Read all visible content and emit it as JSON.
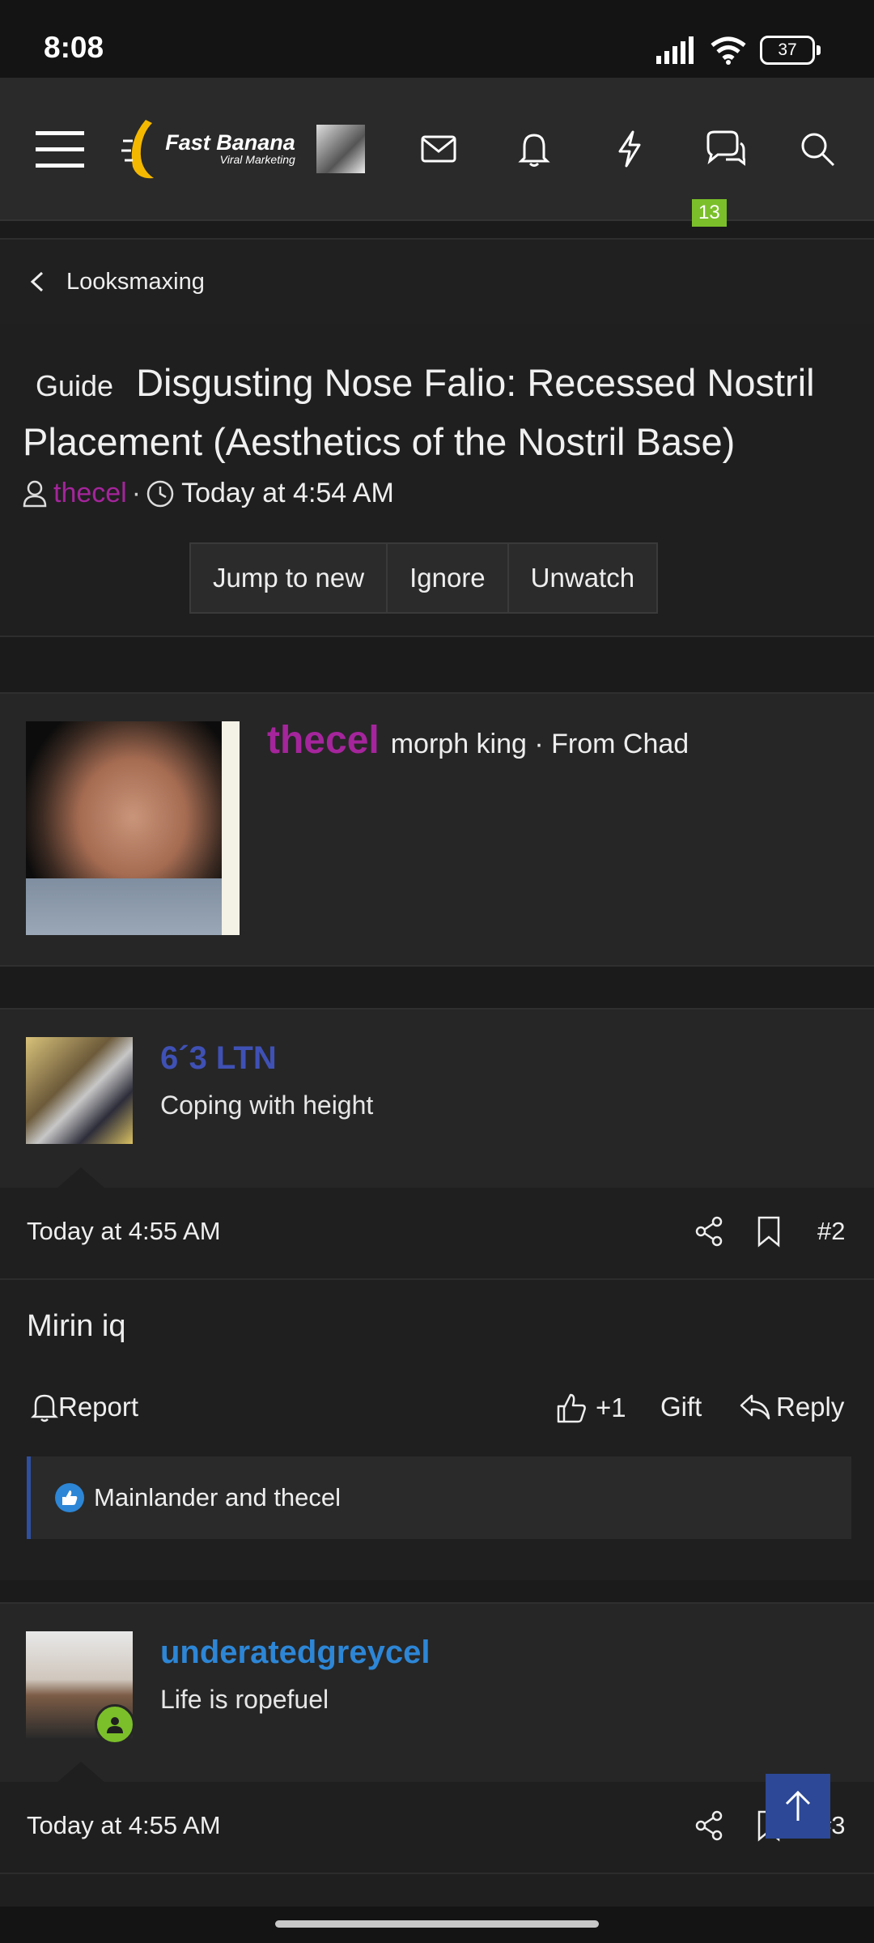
{
  "status": {
    "time": "8:08",
    "battery": "37"
  },
  "nav": {
    "logo_main": "Fast Banana",
    "logo_sub": "Viral Marketing",
    "convo_badge": "13"
  },
  "breadcrumb": {
    "label": "Looksmaxing"
  },
  "thread": {
    "prefix": "Guide",
    "title": "Disgusting Nose Falio: Recessed Nostril Placement (Aesthetics of the Nostril Base)",
    "author": "thecel",
    "separator": "·",
    "time": "Today at 4:54 AM",
    "buttons": [
      "Jump to new",
      "Ignore",
      "Unwatch"
    ]
  },
  "first_post": {
    "username": "thecel",
    "user_title": "morph king · From Chad"
  },
  "posts": [
    {
      "username": "6´3 LTN",
      "user_title": "Coping with height",
      "name_color": "#3f51b5",
      "date": "Today at 4:55 AM",
      "number": "#2",
      "text": "Mirin iq",
      "report_label": "Report",
      "like_label": "+1",
      "gift_label": "Gift",
      "reply_label": "Reply",
      "reactions": "Mainlander and thecel"
    },
    {
      "username": "underatedgreycel",
      "user_title": "Life is ropefuel",
      "name_color": "#2d86d6",
      "date": "Today at 4:55 AM",
      "number": "#3"
    }
  ],
  "colors": {
    "accent_username": "#a5259c",
    "badge_green": "#7bbf2a",
    "scroll_top": "#2c4896"
  }
}
